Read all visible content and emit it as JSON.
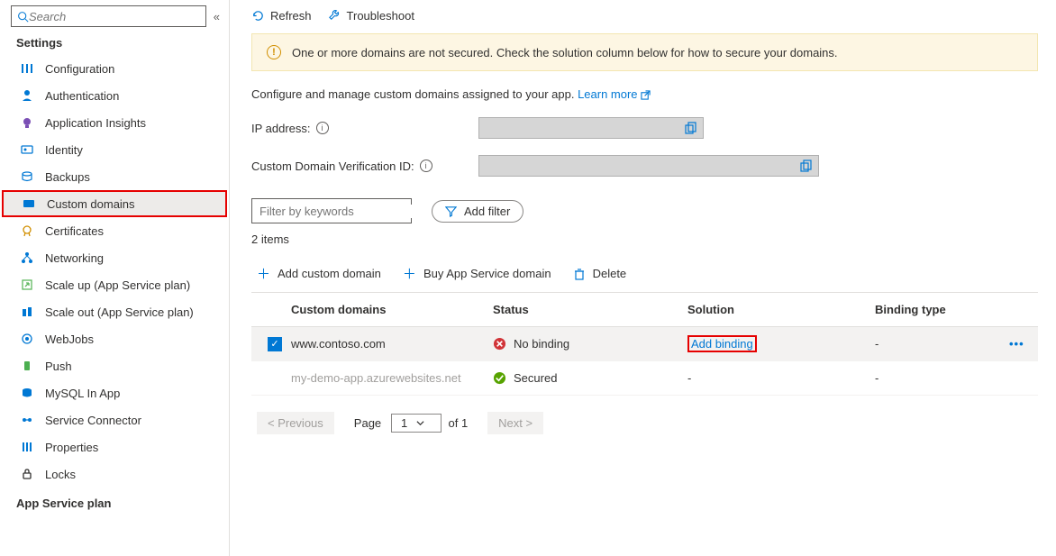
{
  "sidebar": {
    "search_placeholder": "Search",
    "heading": "Settings",
    "items": [
      {
        "label": "Configuration",
        "icon": "sliders",
        "color": "#0078d4"
      },
      {
        "label": "Authentication",
        "icon": "person",
        "color": "#0078d4"
      },
      {
        "label": "Application Insights",
        "icon": "bulb",
        "color": "#7b4fb5"
      },
      {
        "label": "Identity",
        "icon": "id",
        "color": "#0078d4"
      },
      {
        "label": "Backups",
        "icon": "backup",
        "color": "#0078d4"
      },
      {
        "label": "Custom domains",
        "icon": "domain",
        "color": "#0078d4",
        "selected": true
      },
      {
        "label": "Certificates",
        "icon": "cert",
        "color": "#d18f00"
      },
      {
        "label": "Networking",
        "icon": "net",
        "color": "#0078d4"
      },
      {
        "label": "Scale up (App Service plan)",
        "icon": "scaleup",
        "color": "#0078d4"
      },
      {
        "label": "Scale out (App Service plan)",
        "icon": "scaleout",
        "color": "#0078d4"
      },
      {
        "label": "WebJobs",
        "icon": "webjobs",
        "color": "#0078d4"
      },
      {
        "label": "Push",
        "icon": "push",
        "color": "#4caf50"
      },
      {
        "label": "MySQL In App",
        "icon": "mysql",
        "color": "#0078d4"
      },
      {
        "label": "Service Connector",
        "icon": "connector",
        "color": "#0078d4"
      },
      {
        "label": "Properties",
        "icon": "props",
        "color": "#0078d4"
      },
      {
        "label": "Locks",
        "icon": "lock",
        "color": "#323130"
      }
    ],
    "next_heading": "App Service plan"
  },
  "toolbar": {
    "refresh": "Refresh",
    "troubleshoot": "Troubleshoot"
  },
  "alert": "One or more domains are not secured. Check the solution column below for how to secure your domains.",
  "description": {
    "text": "Configure and manage custom domains assigned to your app. ",
    "link": "Learn more"
  },
  "fields": {
    "ip_label": "IP address:",
    "verify_label": "Custom Domain Verification ID:"
  },
  "filter": {
    "placeholder": "Filter by keywords",
    "add": "Add filter"
  },
  "count": "2 items",
  "actions": {
    "add_domain": "Add custom domain",
    "buy_domain": "Buy App Service domain",
    "delete": "Delete"
  },
  "table": {
    "headers": {
      "domain": "Custom domains",
      "status": "Status",
      "solution": "Solution",
      "binding": "Binding type"
    },
    "rows": [
      {
        "domain": "www.contoso.com",
        "status": "No binding",
        "status_type": "error",
        "solution": "Add binding",
        "binding": "-",
        "selected": true
      },
      {
        "domain": "my-demo-app.azurewebsites.net",
        "status": "Secured",
        "status_type": "ok",
        "solution": "-",
        "binding": "-",
        "muted": true
      }
    ]
  },
  "pager": {
    "prev": "< Previous",
    "page_label": "Page",
    "page": "1",
    "of": "of 1",
    "next": "Next >"
  }
}
